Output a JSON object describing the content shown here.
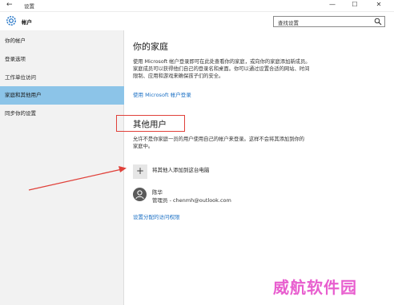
{
  "window": {
    "title": "设置",
    "controls": {
      "minimize": "—",
      "maximize": "☐",
      "close": "✕"
    }
  },
  "header": {
    "title": "帐户",
    "search_placeholder": "查找设置"
  },
  "sidebar": {
    "items": [
      {
        "label": "你的帐户"
      },
      {
        "label": "登录选项"
      },
      {
        "label": "工作单位访问"
      },
      {
        "label": "家庭和其他用户",
        "selected": true
      },
      {
        "label": "同步你的设置"
      }
    ]
  },
  "main": {
    "family_heading": "你的家庭",
    "family_text": "使用 Microsoft 帐户登录即可在此处查看你的家庭，或向你的家庭添加新成员。家庭成员可以获得他们自己的登录名和桌面。你可以通过设置合适的网站、时间限制、应用和游戏来确保孩子们的安全。",
    "family_link": "使用 Microsoft 帐户登录",
    "other_heading": "其他用户",
    "other_text": "允许不是你家庭一员的用户使用自己的帐户来登录。这样不会将其添加到你的家庭中。",
    "add_user_label": "将其他人添加到这台电脑",
    "user": {
      "name": "陈华",
      "detail": "管理员 - chenmh@outlook.com"
    },
    "access_link": "设置分配的访问权限"
  },
  "watermark": "威航软件园",
  "colors": {
    "accent": "#1a6fc4",
    "selected_nav": "#8cc4e8",
    "annotation_red": "#e0413a",
    "watermark": "#e85fcf"
  }
}
